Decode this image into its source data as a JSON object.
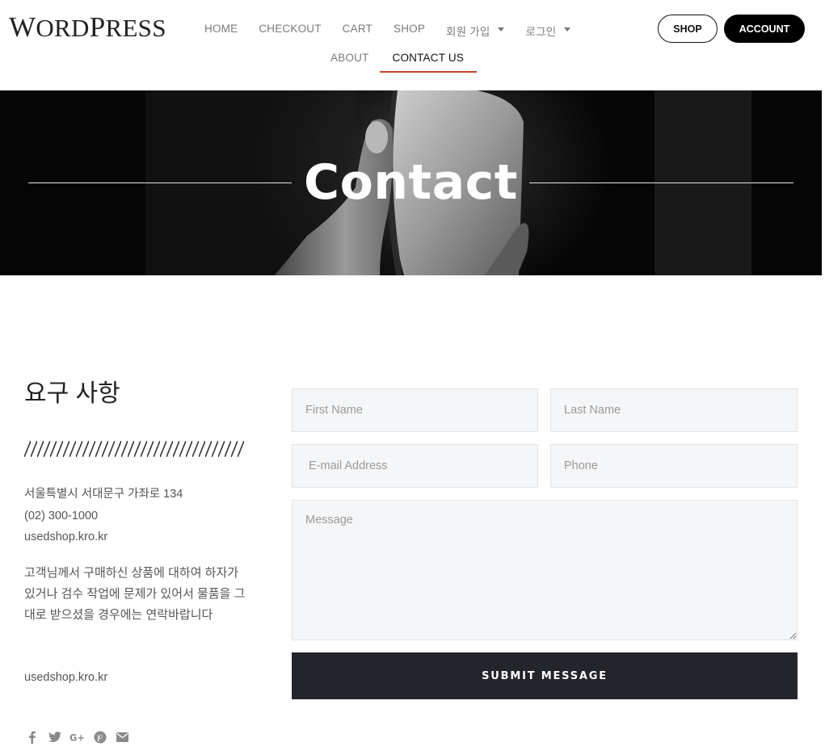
{
  "header": {
    "logo": {
      "first": "W",
      "rest": "ORD",
      "second": "P",
      "rest2": "RESS"
    },
    "nav": [
      {
        "label": "HOME"
      },
      {
        "label": "CHECKOUT"
      },
      {
        "label": "CART"
      },
      {
        "label": "SHOP"
      },
      {
        "label": "회원 가입",
        "dropdown": true
      },
      {
        "label": "로그인",
        "dropdown": true
      }
    ],
    "nav_row2": [
      {
        "label": "ABOUT"
      },
      {
        "label": "CONTACT US",
        "active": true
      }
    ],
    "buttons": {
      "shop": "SHOP",
      "account": "ACCOUNT"
    }
  },
  "hero": {
    "title": "Contact"
  },
  "info": {
    "title": "요구 사항",
    "address": "서울특별시 서대문구 가좌로 134",
    "phone": "(02) 300-1000",
    "website": "usedshop.kro.kr",
    "description": "고객님께서 구매하신 상품에 대하여 하자가 있거나 검수 작업에 문제가 있어서 물품을 그대로 받으셨을 경우에는 연락바랍니다",
    "website2": "usedshop.kro.kr",
    "socials": [
      "facebook-icon",
      "twitter-icon",
      "google-plus-icon",
      "pinterest-icon",
      "envelope-icon"
    ]
  },
  "form": {
    "first_name": "First Name",
    "last_name": "Last Name",
    "email": " E-mail Address",
    "phone": "Phone",
    "message": "Message",
    "submit": "SUBMIT MESSAGE"
  },
  "colors": {
    "accent": "#c4452f",
    "dark": "#23252b",
    "field_bg": "#f5f6f8"
  }
}
